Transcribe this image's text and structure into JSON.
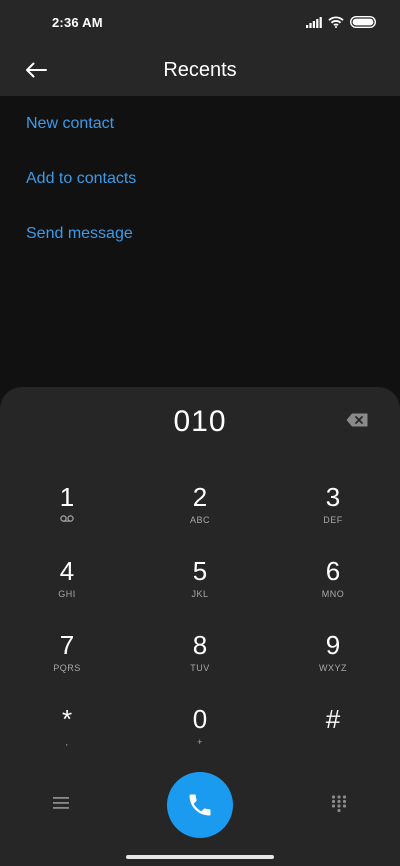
{
  "status_bar": {
    "time": "2:36 AM",
    "icons": [
      "signal-icon",
      "wifi-icon",
      "battery-icon"
    ]
  },
  "header": {
    "title": "Recents",
    "back_icon": "back-arrow-icon"
  },
  "actions": [
    {
      "label": "New contact"
    },
    {
      "label": "Add to contacts"
    },
    {
      "label": "Send message"
    }
  ],
  "dialer": {
    "number": "010",
    "backspace_icon": "backspace-icon",
    "keys": [
      {
        "digit": "1",
        "letters": "",
        "icon": "voicemail-icon"
      },
      {
        "digit": "2",
        "letters": "ABC"
      },
      {
        "digit": "3",
        "letters": "DEF"
      },
      {
        "digit": "4",
        "letters": "GHI"
      },
      {
        "digit": "5",
        "letters": "JKL"
      },
      {
        "digit": "6",
        "letters": "MNO"
      },
      {
        "digit": "7",
        "letters": "PQRS"
      },
      {
        "digit": "8",
        "letters": "TUV"
      },
      {
        "digit": "9",
        "letters": "WXYZ"
      },
      {
        "digit": "*",
        "letters": ","
      },
      {
        "digit": "0",
        "letters": "+"
      },
      {
        "digit": "#",
        "letters": ""
      }
    ],
    "bottom": {
      "left_icon": "menu-icon",
      "center_icon": "call-icon",
      "right_icon": "keypad-icon"
    }
  },
  "colors": {
    "accent": "#3c9be8",
    "call_button": "#1a9bf0",
    "background": "#111111",
    "panel": "#262626"
  }
}
